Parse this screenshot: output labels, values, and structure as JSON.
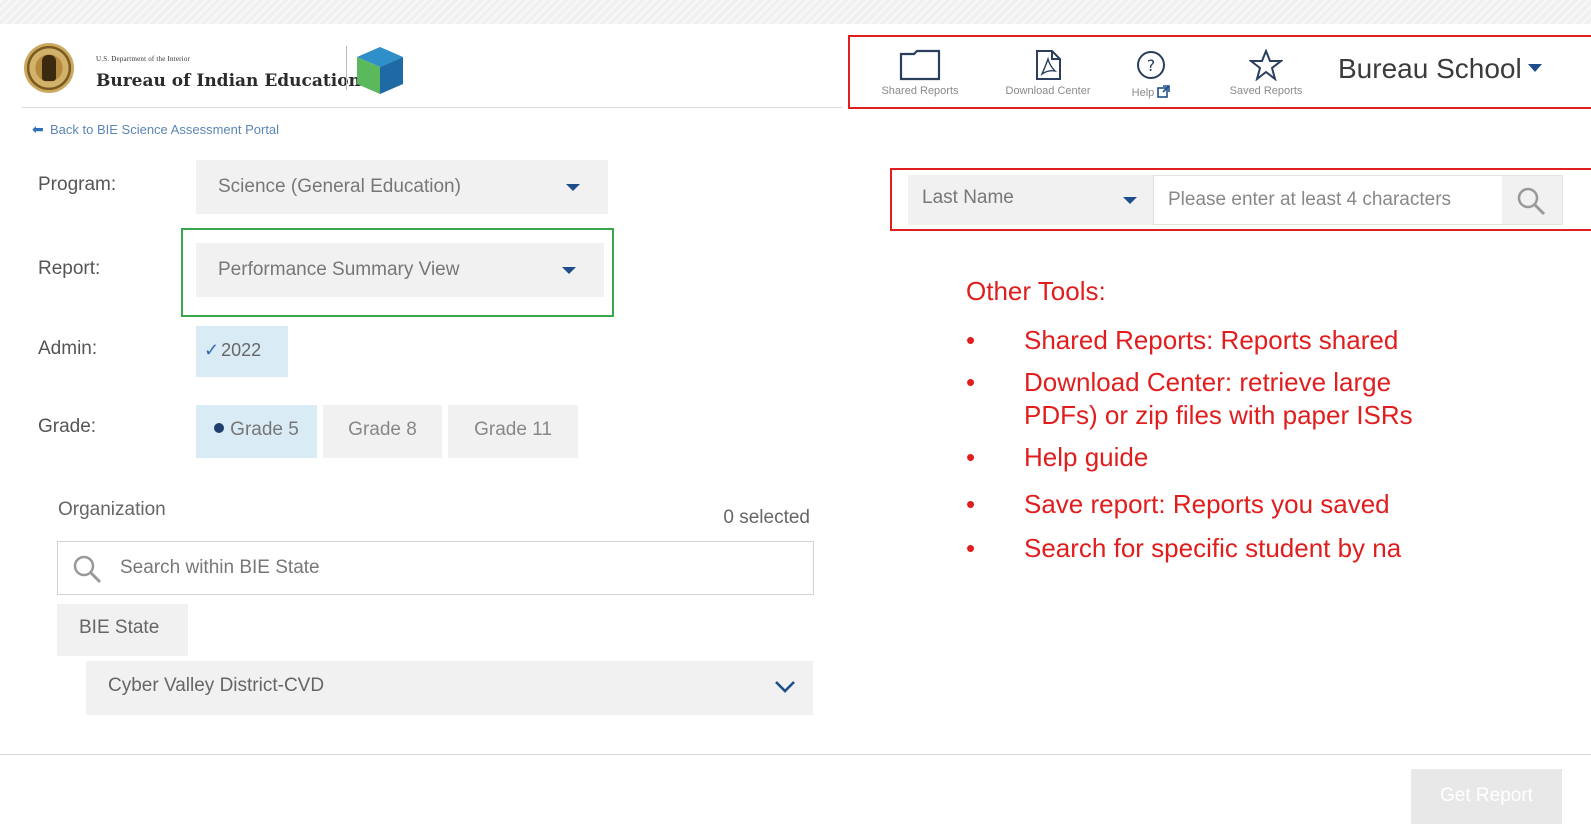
{
  "logo": {
    "department": "U.S. Department of the Interior",
    "bureau": "Bureau of Indian Education"
  },
  "back_link": "Back to BIE Science Assessment Portal",
  "filters": {
    "program_label": "Program:",
    "program_value": "Science (General Education)",
    "report_label": "Report:",
    "report_value": "Performance Summary View",
    "admin_label": "Admin:",
    "admin_value": "2022",
    "grade_label": "Grade:",
    "grades": [
      "Grade 5",
      "Grade 8",
      "Grade 11"
    ],
    "selected_grade": "Grade 5"
  },
  "organization": {
    "label": "Organization",
    "selected_count": "0 selected",
    "search_placeholder": "Search within BIE State",
    "root": "BIE State",
    "district": "Cyber Valley District-CVD"
  },
  "toolbar": {
    "shared_reports": "Shared Reports",
    "download_center": "Download Center",
    "help": "Help",
    "saved_reports": "Saved Reports",
    "user_menu": "Bureau School"
  },
  "student_search": {
    "field": "Last Name",
    "placeholder": "Please enter at least 4 characters"
  },
  "annotation": {
    "heading": "Other Tools:",
    "items": [
      "Shared Reports: Reports shared",
      "Download Center: retrieve large",
      "PDFs) or zip files with paper ISRs",
      "Help guide",
      "Save report: Reports you saved",
      "Search for specific student by na"
    ]
  },
  "actions": {
    "get_report": "Get Report"
  },
  "colors": {
    "annotation_red": "#e01e1e",
    "highlight_green": "#3aa64c",
    "caret_blue": "#1e4e8c",
    "selected_chip": "#d9ecf5"
  }
}
